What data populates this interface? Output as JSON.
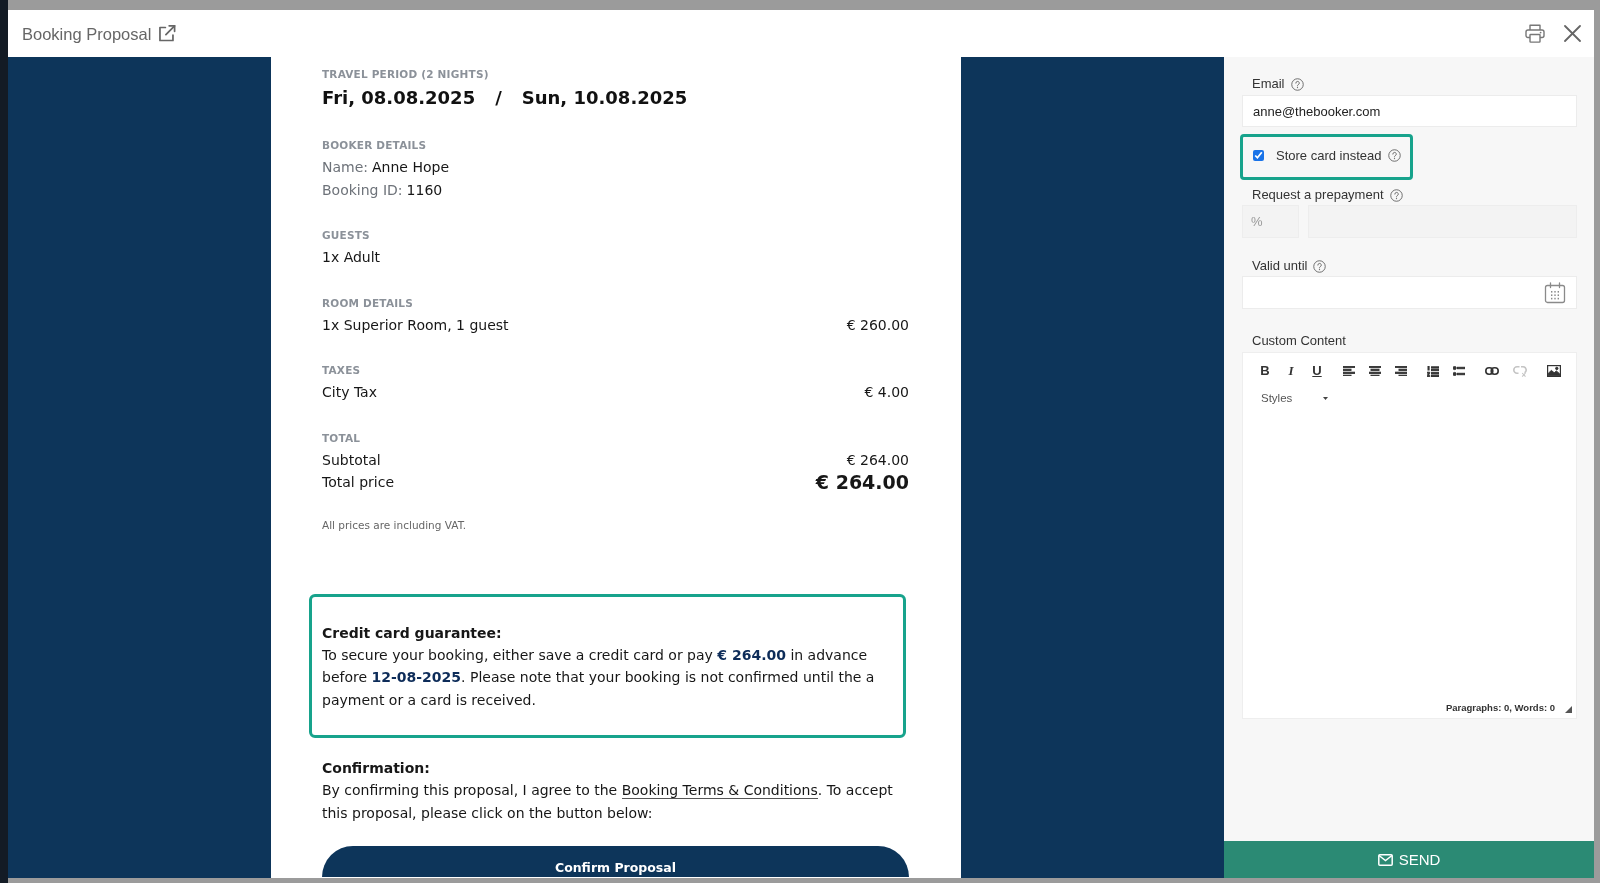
{
  "dialog": {
    "title": "Booking Proposal"
  },
  "document": {
    "sections": [
      {
        "kind": "dates",
        "label": "TRAVEL PERIOD (2 NIGHTS)",
        "start": "Fri, 08.08.2025",
        "separator": "/",
        "end": "Sun, 10.08.2025"
      },
      {
        "kind": "details",
        "label": "BOOKER DETAILS",
        "rows": [
          {
            "label": "Name:",
            "value": "Anne Hope"
          },
          {
            "label": "Booking ID:",
            "value": "1160"
          }
        ]
      },
      {
        "kind": "lines",
        "label": "GUESTS",
        "lines": [
          {
            "text": "1x Adult"
          }
        ]
      },
      {
        "kind": "lines",
        "label": "ROOM DETAILS",
        "lines": [
          {
            "text": "1x Superior Room, 1 guest",
            "amount": "€ 260.00"
          }
        ]
      },
      {
        "kind": "lines",
        "label": "TAXES",
        "lines": [
          {
            "text": "City Tax",
            "amount": "€ 4.00"
          }
        ]
      },
      {
        "kind": "lines",
        "label": "TOTAL",
        "lines": [
          {
            "text": "Subtotal",
            "amount": "€ 264.00",
            "emphasis": false
          },
          {
            "text": "Total price",
            "amount": "€ 264.00",
            "emphasis": true
          }
        ]
      }
    ],
    "note": "All prices are including VAT.",
    "guarantee": {
      "highlighted": true,
      "heading": "Credit card guarantee:",
      "text": "To secure your booking, either save a credit card or pay **€ 264.00** in advance before **12-08-2025**. Please note that your booking is not confirmed until the a payment or a card is received."
    },
    "confirmation": {
      "heading": "Confirmation:",
      "text_before": "By confirming this proposal, I agree to the",
      "link": "Booking Terms & Conditions",
      "text_after": ". To accept this proposal, please click on the button below:",
      "button": "Confirm Proposal"
    }
  },
  "form": {
    "email": {
      "label": "Email",
      "help": true,
      "value": "anne@thebooker.com"
    },
    "store_card": {
      "label": "Store card instead",
      "help": true,
      "checked": true,
      "highlighted": true
    },
    "prepayment": {
      "label": "Request a prepayment",
      "help": true,
      "disabled": true,
      "placeholder": "%"
    },
    "valid_until": {
      "label": "Valid until",
      "help": true
    },
    "custom_content": {
      "label": "Custom Content",
      "toolbar": [
        {
          "kind": "bold",
          "label": "B",
          "disabled": false
        },
        {
          "kind": "italic",
          "label": "I",
          "disabled": false
        },
        {
          "kind": "underline",
          "label": "U",
          "disabled": false
        },
        {
          "kind": "align-left",
          "disabled": false
        },
        {
          "kind": "align-center",
          "disabled": false
        },
        {
          "kind": "align-right",
          "disabled": false
        },
        {
          "kind": "numbered-list",
          "disabled": false
        },
        {
          "kind": "bulleted-list",
          "disabled": false
        },
        {
          "kind": "link",
          "disabled": false
        },
        {
          "kind": "unlink",
          "disabled": true
        },
        {
          "kind": "image",
          "disabled": false
        }
      ],
      "styles": "Styles",
      "status": "Paragraphs: 0, Words: 0"
    },
    "send": "SEND"
  }
}
